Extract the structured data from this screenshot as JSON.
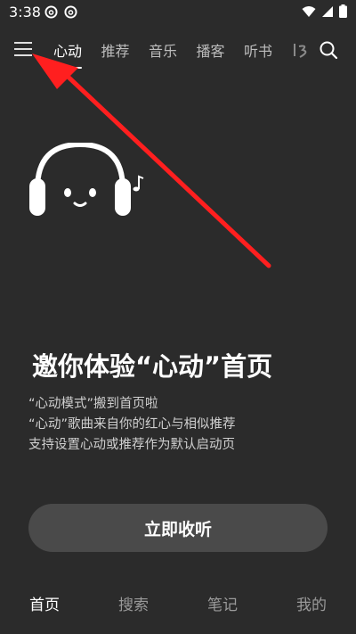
{
  "status_bar": {
    "time": "3:38"
  },
  "top_nav": {
    "tabs": [
      {
        "label": "心动"
      },
      {
        "label": "推荐"
      },
      {
        "label": "音乐"
      },
      {
        "label": "播客"
      },
      {
        "label": "听书"
      }
    ]
  },
  "hero": {
    "headline": "邀你体验“心动”首页",
    "lines": [
      "“心动模式”搬到首页啦",
      "“心动”歌曲来自你的红心与相似推荐",
      "支持设置心动或推荐作为默认启动页"
    ],
    "button_label": "立即收听"
  },
  "bottom_nav": {
    "items": [
      {
        "label": "首页"
      },
      {
        "label": "搜索"
      },
      {
        "label": "笔记"
      },
      {
        "label": "我的"
      }
    ]
  },
  "colors": {
    "background": "#2b2b2b",
    "button": "#4a4a4a",
    "annotation_arrow": "#ff1f1f"
  }
}
